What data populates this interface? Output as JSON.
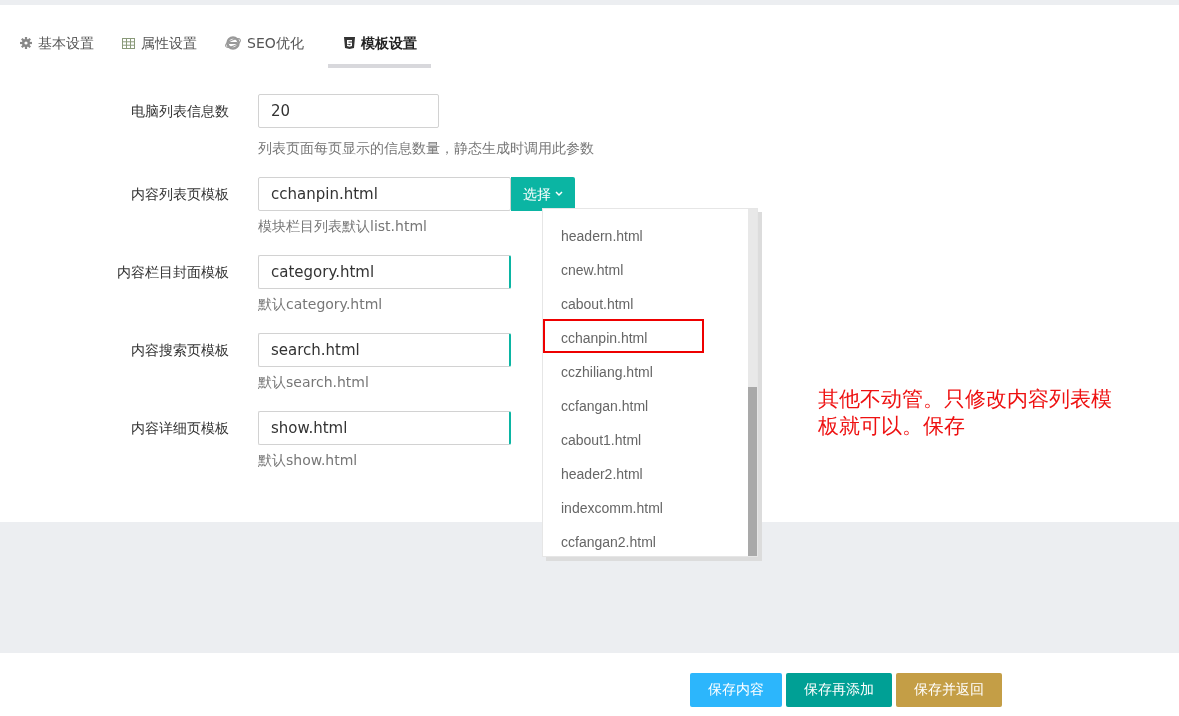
{
  "tabs": [
    {
      "label": "基本设置",
      "kind": "gear",
      "selected": false
    },
    {
      "label": "属性设置",
      "kind": "grid",
      "selected": false
    },
    {
      "label": "SEO优化",
      "kind": "globe",
      "selected": false
    },
    {
      "label": "模板设置",
      "kind": "document",
      "selected": true
    }
  ],
  "fields": [
    {
      "kind": "number",
      "label": "电脑列表信息数",
      "value": "20",
      "help": "列表页面每页显示的信息数量，静态生成时调用此参数"
    },
    {
      "kind": "template",
      "label": "内容列表页模板",
      "value": "cchanpin.html",
      "help": "模块栏目列表默认list.html",
      "button": "选择"
    },
    {
      "kind": "template",
      "label": "内容栏目封面模板",
      "value": "category.html",
      "help": "默认category.html"
    },
    {
      "kind": "template",
      "label": "内容搜索页模板",
      "value": "search.html",
      "help": "默认search.html"
    },
    {
      "kind": "template",
      "label": "内容详细页模板",
      "value": "show.html",
      "help": "默认show.html"
    }
  ],
  "dropdown": {
    "items": [
      {
        "label": "headern.html",
        "annotated": false
      },
      {
        "label": "cnew.html",
        "annotated": false
      },
      {
        "label": "cabout.html",
        "annotated": false
      },
      {
        "label": "cchanpin.html",
        "annotated": true
      },
      {
        "label": "cczhiliang.html",
        "annotated": false
      },
      {
        "label": "ccfangan.html",
        "annotated": false
      },
      {
        "label": "cabout1.html",
        "annotated": false
      },
      {
        "label": "header2.html",
        "annotated": false
      },
      {
        "label": "indexcomm.html",
        "annotated": false
      },
      {
        "label": "ccfangan2.html",
        "annotated": false
      }
    ]
  },
  "annotation": "其他不动管。只修改内容列表模板就可以。保存",
  "buttons": [
    {
      "label": "保存内容",
      "color": "#2cb6fc"
    },
    {
      "label": "保存再添加",
      "color": "#00a095"
    },
    {
      "label": "保存并返回",
      "color": "#c49e46"
    }
  ]
}
